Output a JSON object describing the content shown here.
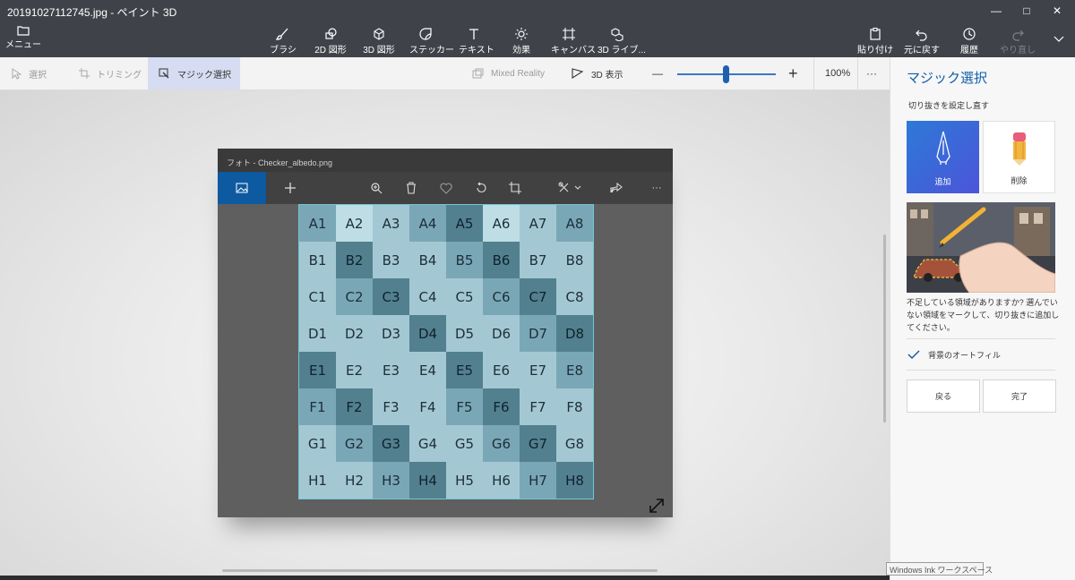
{
  "window": {
    "title": "20191027112745.jpg - ペイント 3D",
    "minimize": "—",
    "maximize": "□",
    "close": "✕"
  },
  "ribbon": {
    "menu": "メニュー",
    "tools": [
      {
        "label": "ブラシ",
        "icon": "brush-icon"
      },
      {
        "label": "2D 図形",
        "icon": "shapes-2d-icon"
      },
      {
        "label": "3D 図形",
        "icon": "shapes-3d-icon"
      },
      {
        "label": "ステッカー",
        "icon": "sticker-icon"
      },
      {
        "label": "テキスト",
        "icon": "text-icon"
      },
      {
        "label": "効果",
        "icon": "effects-icon"
      },
      {
        "label": "キャンバス",
        "icon": "canvas-icon"
      },
      {
        "label": "3D ライブ...",
        "icon": "library-3d-icon"
      }
    ],
    "paste": "貼り付け",
    "undo": "元に戻す",
    "history": "履歴",
    "redo": "やり直し"
  },
  "toolbar": {
    "select": "選択",
    "trim": "トリミング",
    "magic_select": "マジック選択",
    "mixed_reality": "Mixed Reality",
    "view_3d": "3D 表示",
    "zoom_out": "—",
    "zoom_in": "+",
    "zoom": "100%",
    "more": "···"
  },
  "photo": {
    "title": "フォト - Checker_albedo.png",
    "more": "···"
  },
  "board": {
    "rows": [
      [
        "A1",
        "A2",
        "A3",
        "A4",
        "A5",
        "A6",
        "A7",
        "A8"
      ],
      [
        "B1",
        "B2",
        "B3",
        "B4",
        "B5",
        "B6",
        "B7",
        "B8"
      ],
      [
        "C1",
        "C2",
        "C3",
        "C4",
        "C5",
        "C6",
        "C7",
        "C8"
      ],
      [
        "D1",
        "D2",
        "D3",
        "D4",
        "D5",
        "D6",
        "D7",
        "D8"
      ],
      [
        "E1",
        "E2",
        "E3",
        "E4",
        "E5",
        "E6",
        "E7",
        "E8"
      ],
      [
        "F1",
        "F2",
        "F3",
        "F4",
        "F5",
        "F6",
        "F7",
        "F8"
      ],
      [
        "G1",
        "G2",
        "G3",
        "G4",
        "G5",
        "G6",
        "G7",
        "G8"
      ],
      [
        "H1",
        "H2",
        "H3",
        "H4",
        "H5",
        "H6",
        "H7",
        "H8"
      ]
    ],
    "shades": [
      [
        2,
        0,
        1,
        2,
        3,
        0,
        1,
        2
      ],
      [
        1,
        3,
        1,
        1,
        2,
        3,
        1,
        1
      ],
      [
        1,
        2,
        3,
        1,
        1,
        2,
        3,
        1
      ],
      [
        1,
        1,
        1,
        3,
        1,
        1,
        2,
        3
      ],
      [
        3,
        1,
        1,
        1,
        3,
        1,
        1,
        2
      ],
      [
        2,
        3,
        1,
        1,
        2,
        3,
        1,
        1
      ],
      [
        1,
        2,
        3,
        1,
        1,
        2,
        3,
        1
      ],
      [
        1,
        1,
        2,
        3,
        1,
        1,
        2,
        3
      ]
    ],
    "palette": [
      "#bfdde5",
      "#a4c8d3",
      "#7aa7b6",
      "#52808f"
    ]
  },
  "panel": {
    "title": "マジック選択",
    "reset": "切り抜きを設定し直す",
    "add": "追加",
    "delete": "削除",
    "hint": "不足している領域がありますか? 選んでいない領域をマークして、切り抜きに追加してください。",
    "autofill": "背景のオートフィル",
    "autofill_checked": true,
    "back": "戻る",
    "done": "完了"
  },
  "tooltip": {
    "ink": "Windows Ink ワークスペース"
  },
  "colors": {
    "accent": "#0f5fa8",
    "active_tool_bg": "#d6ddf2",
    "ribbon_bg": "#3f4349"
  }
}
